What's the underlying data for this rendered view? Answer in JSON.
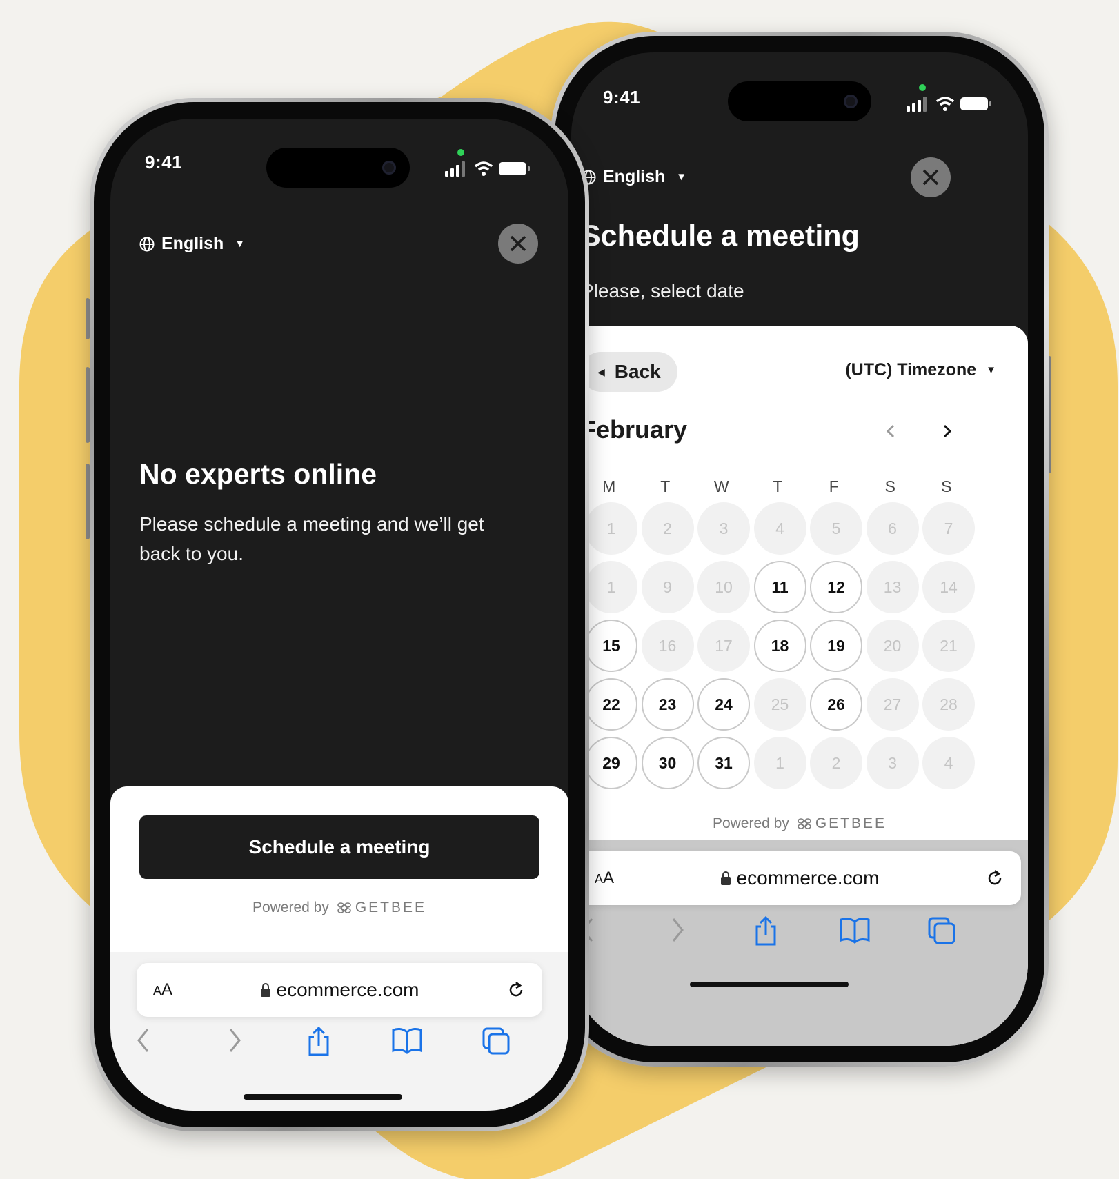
{
  "colors": {
    "background": "#f3f2ee",
    "blob": "#f4cd6a",
    "screen_dark": "#1c1c1c",
    "link_blue": "#1a73e8"
  },
  "phone1": {
    "status_time": "9:41",
    "language": "English",
    "headline": "No experts online",
    "subtext_line1": "Please schedule a meeting and we’ll get",
    "subtext_line2": "back to you.",
    "cta_label": "Schedule a meeting",
    "powered_by": "Powered by",
    "brand": "GETBEE",
    "aa_small": "A",
    "aa_big": "A",
    "url": "ecommerce.com"
  },
  "phone2": {
    "status_time": "9:41",
    "language": "English",
    "title": "Schedule a meeting",
    "subtitle": "Please, select date",
    "back_label": "Back",
    "timezone_label": "(UTC) Timezone",
    "month": "February",
    "weekdays": [
      "M",
      "T",
      "W",
      "T",
      "F",
      "S",
      "S"
    ],
    "days": [
      {
        "label": "1",
        "available": false
      },
      {
        "label": "2",
        "available": false
      },
      {
        "label": "3",
        "available": false
      },
      {
        "label": "4",
        "available": false
      },
      {
        "label": "5",
        "available": false
      },
      {
        "label": "6",
        "available": false
      },
      {
        "label": "7",
        "available": false
      },
      {
        "label": "1",
        "available": false
      },
      {
        "label": "9",
        "available": false
      },
      {
        "label": "10",
        "available": false
      },
      {
        "label": "11",
        "available": true
      },
      {
        "label": "12",
        "available": true
      },
      {
        "label": "13",
        "available": false
      },
      {
        "label": "14",
        "available": false
      },
      {
        "label": "15",
        "available": true
      },
      {
        "label": "16",
        "available": false
      },
      {
        "label": "17",
        "available": false
      },
      {
        "label": "18",
        "available": true
      },
      {
        "label": "19",
        "available": true
      },
      {
        "label": "20",
        "available": false
      },
      {
        "label": "21",
        "available": false
      },
      {
        "label": "22",
        "available": true
      },
      {
        "label": "23",
        "available": true
      },
      {
        "label": "24",
        "available": true
      },
      {
        "label": "25",
        "available": false
      },
      {
        "label": "26",
        "available": true
      },
      {
        "label": "27",
        "available": false
      },
      {
        "label": "28",
        "available": false
      },
      {
        "label": "29",
        "available": true
      },
      {
        "label": "30",
        "available": true
      },
      {
        "label": "31",
        "available": true
      },
      {
        "label": "1",
        "available": false
      },
      {
        "label": "2",
        "available": false
      },
      {
        "label": "3",
        "available": false
      },
      {
        "label": "4",
        "available": false
      }
    ],
    "powered_by": "Powered by",
    "brand": "GETBEE",
    "aa_small": "A",
    "aa_big": "A",
    "url": "ecommerce.com"
  }
}
